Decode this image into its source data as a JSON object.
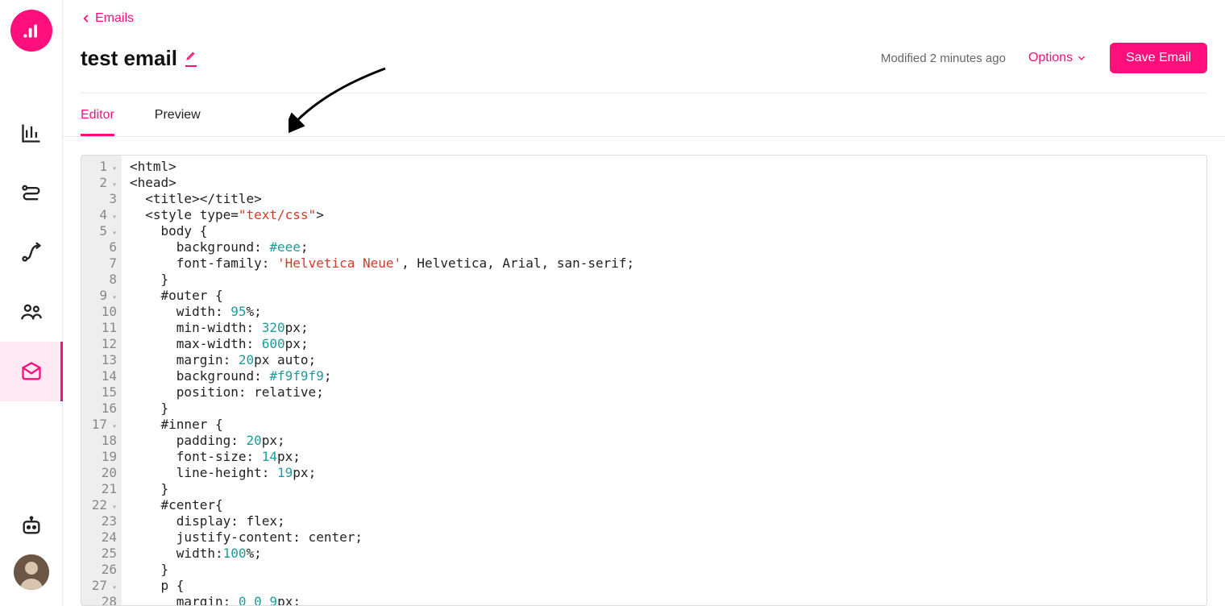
{
  "breadcrumb": {
    "label": "Emails"
  },
  "title": "test email",
  "modified": "Modified 2 minutes ago",
  "options_label": "Options",
  "save_label": "Save Email",
  "tabs": {
    "editor": "Editor",
    "preview": "Preview"
  },
  "code": {
    "lines": [
      {
        "n": 1,
        "fold": true
      },
      {
        "n": 2,
        "fold": true
      },
      {
        "n": 3,
        "fold": false
      },
      {
        "n": 4,
        "fold": true
      },
      {
        "n": 5,
        "fold": true
      },
      {
        "n": 6,
        "fold": false
      },
      {
        "n": 7,
        "fold": false
      },
      {
        "n": 8,
        "fold": false
      },
      {
        "n": 9,
        "fold": true
      },
      {
        "n": 10,
        "fold": false
      },
      {
        "n": 11,
        "fold": false
      },
      {
        "n": 12,
        "fold": false
      },
      {
        "n": 13,
        "fold": false
      },
      {
        "n": 14,
        "fold": false
      },
      {
        "n": 15,
        "fold": false
      },
      {
        "n": 16,
        "fold": false
      },
      {
        "n": 17,
        "fold": true
      },
      {
        "n": 18,
        "fold": false
      },
      {
        "n": 19,
        "fold": false
      },
      {
        "n": 20,
        "fold": false
      },
      {
        "n": 21,
        "fold": false
      },
      {
        "n": 22,
        "fold": true
      },
      {
        "n": 23,
        "fold": false
      },
      {
        "n": 24,
        "fold": false
      },
      {
        "n": 25,
        "fold": false
      },
      {
        "n": 26,
        "fold": false
      },
      {
        "n": 27,
        "fold": true
      },
      {
        "n": 28,
        "fold": false
      }
    ],
    "source": [
      "<html>",
      "<head>",
      "  <title></title>",
      "  <style type=\"text/css\">",
      "    body {",
      "      background: #eee;",
      "      font-family: 'Helvetica Neue', Helvetica, Arial, san-serif;",
      "    }",
      "    #outer {",
      "      width: 95%;",
      "      min-width: 320px;",
      "      max-width: 600px;",
      "      margin: 20px auto;",
      "      background: #f9f9f9;",
      "      position: relative;",
      "    }",
      "    #inner {",
      "      padding: 20px;",
      "      font-size: 14px;",
      "      line-height: 19px;",
      "    }",
      "    #center{",
      "      display: flex;",
      "      justify-content: center;",
      "      width:100%;",
      "    }",
      "    p {",
      "      margin: 0 0 9px;"
    ]
  }
}
